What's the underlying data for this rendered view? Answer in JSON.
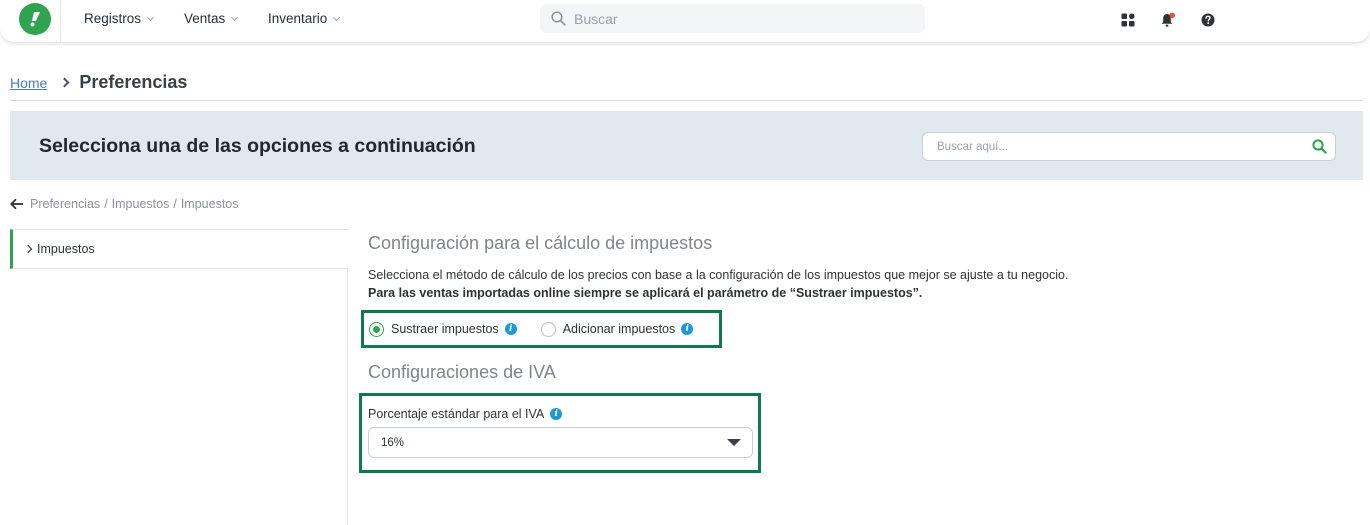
{
  "topnav": {
    "items": [
      {
        "label": "Registros"
      },
      {
        "label": "Ventas"
      },
      {
        "label": "Inventario"
      }
    ],
    "search_placeholder": "Buscar"
  },
  "page": {
    "home_link": "Home",
    "title": "Preferencias"
  },
  "banner": {
    "title": "Selecciona una de las opciones a continuación",
    "search_placeholder": "Buscar aquí..."
  },
  "sub_breadcrumb": {
    "items": [
      "Preferencias",
      "Impuestos",
      "Impuestos"
    ]
  },
  "left_menu": {
    "items": [
      {
        "label": "Impuestos",
        "active": true
      }
    ]
  },
  "tax_calc": {
    "title": "Configuración para el cálculo de impuestos",
    "description": "Selecciona el método de cálculo de los precios con base a la configuración de los impuestos que mejor se ajuste a tu negocio.",
    "note": "Para las ventas importadas online siempre se aplicará el parámetro de “Sustraer impuestos”.",
    "options": [
      {
        "label": "Sustraer impuestos",
        "selected": true
      },
      {
        "label": "Adicionar impuestos",
        "selected": false
      }
    ]
  },
  "iva": {
    "title": "Configuraciones de IVA",
    "field_label": "Porcentaje estándar para el IVA",
    "selected_value": "16%"
  },
  "colors": {
    "brand_green": "#2ea44f",
    "highlight_border": "#0e7a4b",
    "banner_bg": "#dfe9ee",
    "info_blue": "#1a9ad6",
    "notification_red": "#e74c3c"
  }
}
